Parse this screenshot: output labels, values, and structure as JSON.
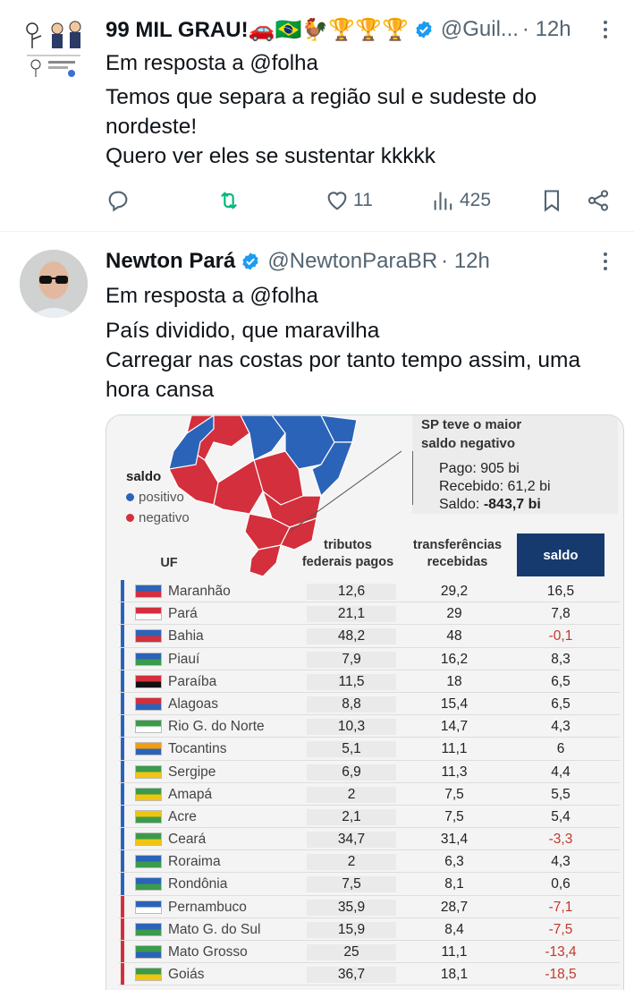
{
  "tweet1": {
    "name": "99 MIL GRAU!🚗🇧🇷🐓🏆🏆🏆",
    "handle": "@Guil...",
    "time": "· 12h",
    "reply_to": "Em resposta a @folha",
    "lines": [
      "Temos que separa a região sul e sudeste do",
      "nordeste!",
      "Quero ver eles se sustentar kkkkk"
    ],
    "likes": "11",
    "views": "425",
    "icons": [
      "reply-icon",
      "retweet-icon",
      "heart-icon",
      "views-icon",
      "bookmark-icon",
      "share-icon"
    ],
    "retweet_color": "#00ba7c"
  },
  "tweet2": {
    "name": "Newton Pará",
    "handle": "@NewtonParaBR",
    "time": "· 12h",
    "reply_to": "Em resposta a @folha",
    "lines": [
      "País dividido, que maravilha",
      "Carregar nas costas por tanto tempo assim, uma",
      "hora cansa"
    ],
    "verified_color": "#1d9bf0"
  },
  "image": {
    "legend_title": "saldo",
    "legend_pos": "positivo",
    "legend_neg": "negativo",
    "positive_color": "#2b63b8",
    "negative_color": "#d32f3c",
    "sp_title_1": "SP teve o maior",
    "sp_title_2": "saldo negativo",
    "sp_pago": "Pago: 905 bi",
    "sp_recebido": "Recebido: 61,2 bi",
    "sp_saldo_label": "Saldo: ",
    "sp_saldo_value": "-843,7 bi",
    "col_uf": "UF",
    "col_tributos_1": "tributos",
    "col_tributos_2": "federais pagos",
    "col_transf_1": "transferências",
    "col_transf_2": "recebidas",
    "col_saldo": "saldo",
    "rows": [
      {
        "uf": "Maranhão",
        "trib": "12,6",
        "transf": "29,2",
        "saldo": "16,5",
        "neg": false
      },
      {
        "uf": "Pará",
        "trib": "21,1",
        "transf": "29",
        "saldo": "7,8",
        "neg": false
      },
      {
        "uf": "Bahia",
        "trib": "48,2",
        "transf": "48",
        "saldo": "-0,1",
        "neg": true
      },
      {
        "uf": "Piauí",
        "trib": "7,9",
        "transf": "16,2",
        "saldo": "8,3",
        "neg": false
      },
      {
        "uf": "Paraíba",
        "trib": "11,5",
        "transf": "18",
        "saldo": "6,5",
        "neg": false
      },
      {
        "uf": "Alagoas",
        "trib": "8,8",
        "transf": "15,4",
        "saldo": "6,5",
        "neg": false
      },
      {
        "uf": "Rio G. do Norte",
        "trib": "10,3",
        "transf": "14,7",
        "saldo": "4,3",
        "neg": false
      },
      {
        "uf": "Tocantins",
        "trib": "5,1",
        "transf": "11,1",
        "saldo": "6",
        "neg": false
      },
      {
        "uf": "Sergipe",
        "trib": "6,9",
        "transf": "11,3",
        "saldo": "4,4",
        "neg": false
      },
      {
        "uf": "Amapá",
        "trib": "2",
        "transf": "7,5",
        "saldo": "5,5",
        "neg": false
      },
      {
        "uf": "Acre",
        "trib": "2,1",
        "transf": "7,5",
        "saldo": "5,4",
        "neg": false
      },
      {
        "uf": "Ceará",
        "trib": "34,7",
        "transf": "31,4",
        "saldo": "-3,3",
        "neg": true
      },
      {
        "uf": "Roraima",
        "trib": "2",
        "transf": "6,3",
        "saldo": "4,3",
        "neg": false
      },
      {
        "uf": "Rondônia",
        "trib": "7,5",
        "transf": "8,1",
        "saldo": "0,6",
        "neg": false
      },
      {
        "uf": "Pernambuco",
        "trib": "35,9",
        "transf": "28,7",
        "saldo": "-7,1",
        "neg": true
      },
      {
        "uf": "Mato G. do Sul",
        "trib": "15,9",
        "transf": "8,4",
        "saldo": "-7,5",
        "neg": true
      },
      {
        "uf": "Mato Grosso",
        "trib": "25",
        "transf": "11,1",
        "saldo": "-13,4",
        "neg": true
      },
      {
        "uf": "Goiás",
        "trib": "36,7",
        "transf": "18,1",
        "saldo": "-18,5",
        "neg": true
      }
    ]
  }
}
